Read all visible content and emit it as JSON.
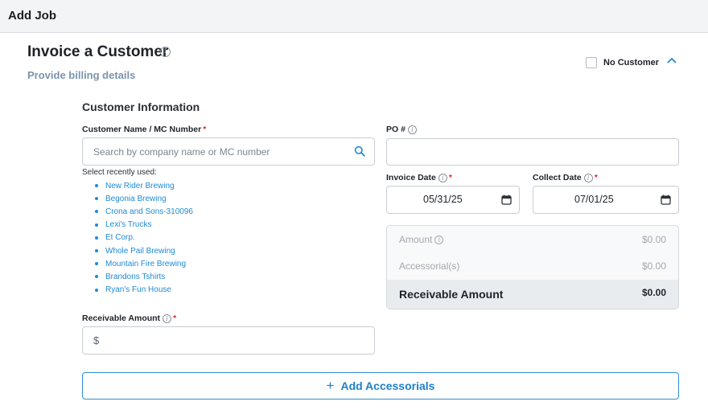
{
  "header": {
    "title": "Add Job"
  },
  "section": {
    "title": "Invoice a Customer",
    "subtitle": "Provide billing details",
    "no_customer_label": "No Customer",
    "no_customer_checked": false
  },
  "customer_info": {
    "title": "Customer Information",
    "name_label": "Customer Name / MC Number",
    "required_mark": "*",
    "search_placeholder": "Search by company name or MC number",
    "recent_title": "Select recently used:",
    "recent": [
      "New Rider Brewing",
      "Begonia Brewing",
      "Crona and Sons-310096",
      "Lexi's Trucks",
      "Et Corp.",
      "Whole Pail Brewing",
      "Mountain Fire Brewing",
      "Brandons Tshirts",
      "Ryan's Fun House"
    ]
  },
  "po": {
    "label": "PO #",
    "value": ""
  },
  "invoice_date": {
    "label": "Invoice Date",
    "value": "05/31/25"
  },
  "collect_date": {
    "label": "Collect Date",
    "value": "07/01/25"
  },
  "summary": {
    "amount_label": "Amount",
    "amount_value": "$0.00",
    "accessorials_label": "Accessorial(s)",
    "accessorials_value": "$0.00",
    "receivable_label": "Receivable Amount",
    "receivable_value": "$0.00"
  },
  "receivable": {
    "label": "Receivable Amount",
    "currency": "$"
  },
  "add_accessorials": {
    "icon": "+",
    "label": "Add Accessorials"
  },
  "colors": {
    "accent": "#1e8ad6",
    "required": "#d92d20",
    "subtitle": "#7a94ad"
  }
}
